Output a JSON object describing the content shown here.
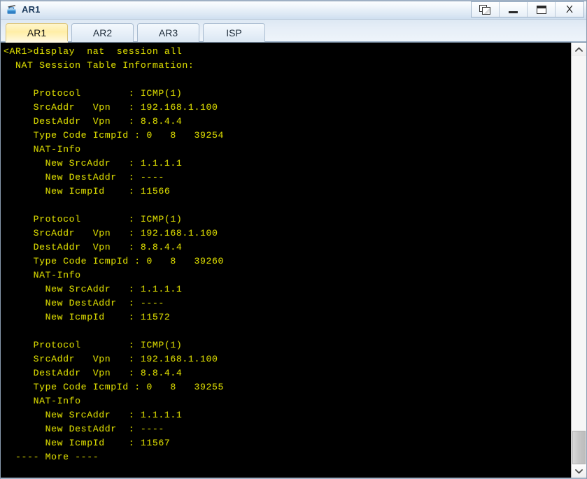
{
  "window": {
    "title": "AR1",
    "icon": "router-icon",
    "controls": [
      {
        "name": "restore-down-button",
        "label": "Restore",
        "glyph": "restore-icon"
      },
      {
        "name": "minimize-button",
        "label": "Minimize",
        "glyph": "minimize-icon"
      },
      {
        "name": "maximize-button",
        "label": "Maximize",
        "glyph": "maximize-icon"
      },
      {
        "name": "close-button",
        "label": "X",
        "glyph": "close-icon"
      }
    ]
  },
  "tabs": [
    {
      "label": "AR1",
      "active": true
    },
    {
      "label": "AR2",
      "active": false
    },
    {
      "label": "AR3",
      "active": false
    },
    {
      "label": "ISP",
      "active": false
    }
  ],
  "console": {
    "colors": {
      "background": "#000000",
      "text": "#d6d600"
    },
    "prompt": "<AR1>",
    "command": "display  nat  session all",
    "header": "NAT Session Table Information:",
    "sessions": [
      {
        "protocol_label": "Protocol",
        "protocol_value": "ICMP(1)",
        "srcaddr_label": "SrcAddr   Vpn",
        "srcaddr_value": "192.168.1.100",
        "destaddr_label": "DestAddr  Vpn",
        "destaddr_value": "8.8.4.4",
        "typecode_label": "Type Code IcmpId",
        "typecode_value": "0   8   39254",
        "natinfo_label": "NAT-Info",
        "new_srcaddr_label": "New SrcAddr",
        "new_srcaddr_value": "1.1.1.1",
        "new_destaddr_label": "New DestAddr",
        "new_destaddr_value": "----",
        "new_icmpid_label": "New IcmpId",
        "new_icmpid_value": "11566"
      },
      {
        "protocol_label": "Protocol",
        "protocol_value": "ICMP(1)",
        "srcaddr_label": "SrcAddr   Vpn",
        "srcaddr_value": "192.168.1.100",
        "destaddr_label": "DestAddr  Vpn",
        "destaddr_value": "8.8.4.4",
        "typecode_label": "Type Code IcmpId",
        "typecode_value": "0   8   39260",
        "natinfo_label": "NAT-Info",
        "new_srcaddr_label": "New SrcAddr",
        "new_srcaddr_value": "1.1.1.1",
        "new_destaddr_label": "New DestAddr",
        "new_destaddr_value": "----",
        "new_icmpid_label": "New IcmpId",
        "new_icmpid_value": "11572"
      },
      {
        "protocol_label": "Protocol",
        "protocol_value": "ICMP(1)",
        "srcaddr_label": "SrcAddr   Vpn",
        "srcaddr_value": "192.168.1.100",
        "destaddr_label": "DestAddr  Vpn",
        "destaddr_value": "8.8.4.4",
        "typecode_label": "Type Code IcmpId",
        "typecode_value": "0   8   39255",
        "natinfo_label": "NAT-Info",
        "new_srcaddr_label": "New SrcAddr",
        "new_srcaddr_value": "1.1.1.1",
        "new_destaddr_label": "New DestAddr",
        "new_destaddr_value": "----",
        "new_icmpid_label": "New IcmpId",
        "new_icmpid_value": "11567"
      }
    ],
    "more_prompt": "---- More ----",
    "text": "<AR1>display  nat  session all\n  NAT Session Table Information:\n\n     Protocol        : ICMP(1)\n     SrcAddr   Vpn   : 192.168.1.100\n     DestAddr  Vpn   : 8.8.4.4\n     Type Code IcmpId : 0   8   39254\n     NAT-Info\n       New SrcAddr   : 1.1.1.1\n       New DestAddr  : ----\n       New IcmpId    : 11566\n\n     Protocol        : ICMP(1)\n     SrcAddr   Vpn   : 192.168.1.100\n     DestAddr  Vpn   : 8.8.4.4\n     Type Code IcmpId : 0   8   39260\n     NAT-Info\n       New SrcAddr   : 1.1.1.1\n       New DestAddr  : ----\n       New IcmpId    : 11572\n\n     Protocol        : ICMP(1)\n     SrcAddr   Vpn   : 192.168.1.100\n     DestAddr  Vpn   : 8.8.4.4\n     Type Code IcmpId : 0   8   39255\n     NAT-Info\n       New SrcAddr   : 1.1.1.1\n       New DestAddr  : ----\n       New IcmpId    : 11567\n  ---- More ----"
  },
  "scrollbar": {
    "up_arrow": "chevron-up-icon",
    "down_arrow": "chevron-down-icon"
  }
}
